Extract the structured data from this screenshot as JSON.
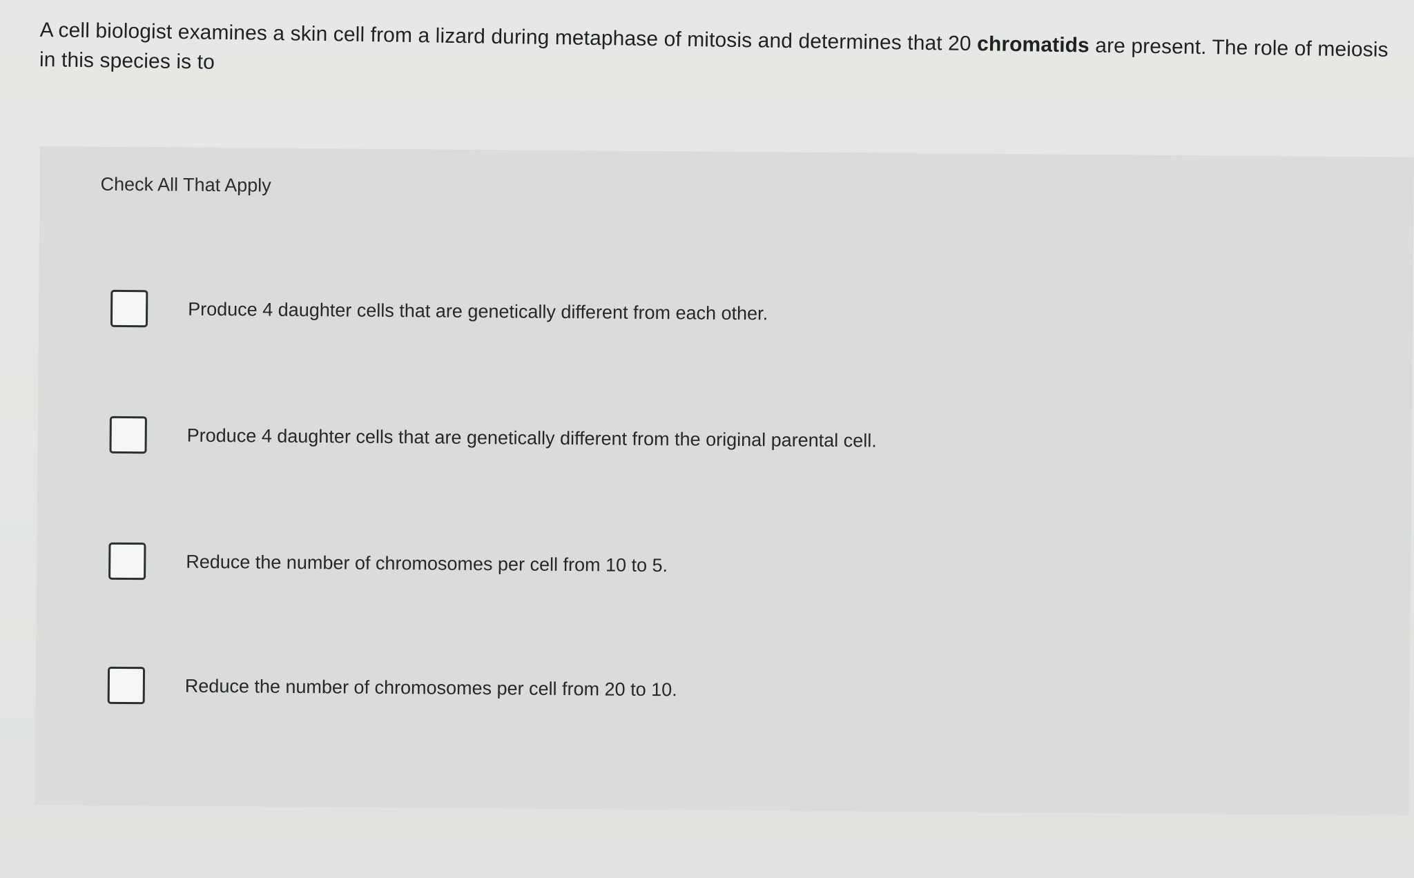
{
  "question": {
    "text_before_bold": "A cell biologist examines a skin cell from a lizard during metaphase of mitosis and determines that 20 ",
    "bold_term": "chromatids",
    "text_after_bold": " are present. The role of meiosis in this species is to"
  },
  "instruction": "Check All That Apply",
  "options": [
    {
      "label": "Produce 4 daughter cells that are genetically different from each other."
    },
    {
      "label": "Produce 4 daughter cells that are genetically different from the original parental cell."
    },
    {
      "label": "Reduce the number of chromosomes per cell from 10 to 5."
    },
    {
      "label": "Reduce the number of chromosomes per cell from 20 to 10."
    }
  ]
}
